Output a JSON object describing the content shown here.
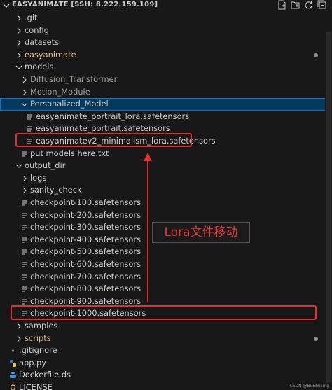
{
  "explorer": {
    "title": "EASYANIMATE [SSH: 8.222.159.109]",
    "actions": [
      "new-file-icon",
      "new-folder-icon",
      "refresh-icon",
      "collapse-all-icon"
    ]
  },
  "tree": [
    {
      "label": ".git",
      "type": "folder",
      "depth": 1,
      "expanded": false,
      "dim": false
    },
    {
      "label": "config",
      "type": "folder",
      "depth": 1,
      "expanded": false
    },
    {
      "label": "datasets",
      "type": "folder",
      "depth": 1,
      "expanded": false
    },
    {
      "label": "easyanimate",
      "type": "folder",
      "depth": 1,
      "expanded": false,
      "modified": true
    },
    {
      "label": "models",
      "type": "folder",
      "depth": 1,
      "expanded": true
    },
    {
      "label": "Diffusion_Transformer",
      "type": "folder",
      "depth": 2,
      "expanded": false,
      "dim": true
    },
    {
      "label": "Motion_Module",
      "type": "folder",
      "depth": 2,
      "expanded": false,
      "dim": true
    },
    {
      "label": "Personalized_Model",
      "type": "folder",
      "depth": 2,
      "expanded": true,
      "selected": true
    },
    {
      "label": "easyanimate_portrait_lora.safetensors",
      "type": "file",
      "depth": 3
    },
    {
      "label": "easyanimate_portrait.safetensors",
      "type": "file",
      "depth": 3
    },
    {
      "label": "easyanimatev2_minimalism_lora.safetensors",
      "type": "file",
      "depth": 3
    },
    {
      "label": "put models here.txt",
      "type": "file",
      "depth": 2
    },
    {
      "label": "output_dir",
      "type": "folder",
      "depth": 1,
      "expanded": true
    },
    {
      "label": "logs",
      "type": "folder",
      "depth": 2,
      "expanded": false
    },
    {
      "label": "sanity_check",
      "type": "folder",
      "depth": 2,
      "expanded": false
    },
    {
      "label": "checkpoint-100.safetensors",
      "type": "file",
      "depth": 2
    },
    {
      "label": "checkpoint-200.safetensors",
      "type": "file",
      "depth": 2
    },
    {
      "label": "checkpoint-300.safetensors",
      "type": "file",
      "depth": 2
    },
    {
      "label": "checkpoint-400.safetensors",
      "type": "file",
      "depth": 2
    },
    {
      "label": "checkpoint-500.safetensors",
      "type": "file",
      "depth": 2
    },
    {
      "label": "checkpoint-600.safetensors",
      "type": "file",
      "depth": 2
    },
    {
      "label": "checkpoint-700.safetensors",
      "type": "file",
      "depth": 2
    },
    {
      "label": "checkpoint-800.safetensors",
      "type": "file",
      "depth": 2
    },
    {
      "label": "checkpoint-900.safetensors",
      "type": "file",
      "depth": 2
    },
    {
      "label": "checkpoint-1000.safetensors",
      "type": "file",
      "depth": 2
    },
    {
      "label": "samples",
      "type": "folder",
      "depth": 1,
      "expanded": false
    },
    {
      "label": "scripts",
      "type": "folder",
      "depth": 1,
      "expanded": false,
      "modified": true
    },
    {
      "label": ".gitignore",
      "type": "gitignore",
      "depth": 0
    },
    {
      "label": "app.py",
      "type": "python",
      "depth": 0
    },
    {
      "label": "Dockerfile.ds",
      "type": "docker",
      "depth": 0
    },
    {
      "label": "LICENSE",
      "type": "license",
      "depth": 0
    }
  ],
  "annotation": {
    "text": "Lora文件移动",
    "color": "#e33a3a"
  },
  "colors": {
    "background": "#181818",
    "selected": "#04395e",
    "modified": "#e2c08d",
    "highlight_box": "#e03030"
  },
  "watermark": "CSDN @Bubbliiiing"
}
